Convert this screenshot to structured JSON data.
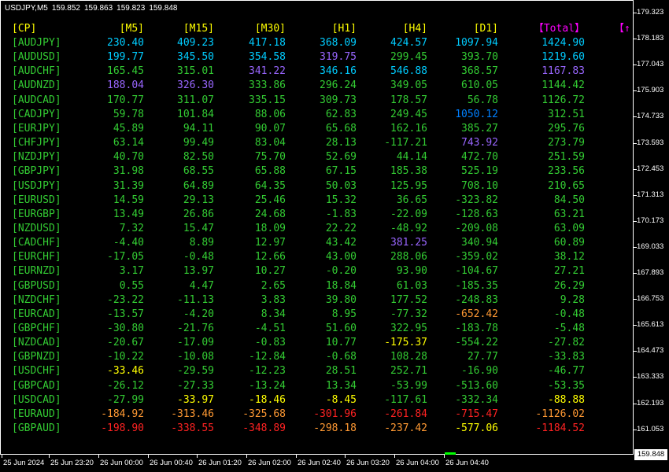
{
  "chart_header": {
    "symbol": "USDJPY,M5",
    "open": "159.852",
    "high": "159.863",
    "low": "159.823",
    "close": "159.848"
  },
  "price_scale": [
    "179.323",
    "178.183",
    "177.043",
    "175.903",
    "174.733",
    "173.593",
    "172.453",
    "171.313",
    "170.173",
    "169.033",
    "167.893",
    "166.753",
    "165.613",
    "164.473",
    "163.333",
    "162.193",
    "161.053"
  ],
  "current_price": "159.848",
  "time_scale": [
    "25 Jun 2024",
    "25 Jun 23:20",
    "26 Jun 00:00",
    "26 Jun 00:40",
    "26 Jun 01:20",
    "26 Jun 02:00",
    "26 Jun 02:40",
    "26 Jun 03:20",
    "26 Jun 04:00",
    "26 Jun 04:40"
  ],
  "table_headers": [
    "[CP]",
    "[M5]",
    "[M15]",
    "[M30]",
    "[H1]",
    "[H4]",
    "[D1]",
    "【Total】",
    "【↑"
  ],
  "header_colors": [
    "#ffff00",
    "#ffff00",
    "#ffff00",
    "#ffff00",
    "#ffff00",
    "#ffff00",
    "#ffff00",
    "#ff00ff",
    "#ff00ff"
  ],
  "colors": {
    "cyan": "#00ccff",
    "blue": "#0080ff",
    "purple": "#9966ff",
    "green": "#33cc33",
    "lime": "#00ff00",
    "yellow": "#ffff00",
    "orange": "#ff9933",
    "red": "#ff2222",
    "label": "#33cc33"
  },
  "rows": [
    {
      "pair": "[AUDJPY]",
      "values": [
        "230.40",
        "409.23",
        "417.18",
        "368.09",
        "424.57",
        "1097.94",
        "1424.90"
      ],
      "colors": [
        "cyan",
        "cyan",
        "cyan",
        "cyan",
        "cyan",
        "cyan",
        "cyan"
      ]
    },
    {
      "pair": "[AUDUSD]",
      "values": [
        "199.77",
        "345.50",
        "354.58",
        "319.75",
        "299.45",
        "393.70",
        "1219.60"
      ],
      "colors": [
        "cyan",
        "cyan",
        "cyan",
        "purple",
        "green",
        "green",
        "cyan"
      ]
    },
    {
      "pair": "[AUDCHF]",
      "values": [
        "165.45",
        "315.01",
        "341.22",
        "346.16",
        "546.88",
        "368.57",
        "1167.83"
      ],
      "colors": [
        "green",
        "green",
        "purple",
        "cyan",
        "cyan",
        "green",
        "purple"
      ]
    },
    {
      "pair": "[AUDNZD]",
      "values": [
        "188.04",
        "326.30",
        "333.86",
        "296.24",
        "349.05",
        "610.05",
        "1144.42"
      ],
      "colors": [
        "purple",
        "purple",
        "green",
        "green",
        "green",
        "green",
        "green"
      ]
    },
    {
      "pair": "[AUDCAD]",
      "values": [
        "170.77",
        "311.07",
        "335.15",
        "309.73",
        "178.57",
        "56.78",
        "1126.72"
      ],
      "colors": [
        "green",
        "green",
        "green",
        "green",
        "green",
        "green",
        "green"
      ]
    },
    {
      "pair": "[CADJPY]",
      "values": [
        "59.78",
        "101.84",
        "88.06",
        "62.83",
        "249.45",
        "1050.12",
        "312.51"
      ],
      "colors": [
        "green",
        "green",
        "green",
        "green",
        "green",
        "blue",
        "green"
      ]
    },
    {
      "pair": "[EURJPY]",
      "values": [
        "45.89",
        "94.11",
        "90.07",
        "65.68",
        "162.16",
        "385.27",
        "295.76"
      ],
      "colors": [
        "green",
        "green",
        "green",
        "green",
        "green",
        "green",
        "green"
      ]
    },
    {
      "pair": "[CHFJPY]",
      "values": [
        "63.14",
        "99.49",
        "83.04",
        "28.13",
        "-117.21",
        "743.92",
        "273.79"
      ],
      "colors": [
        "green",
        "green",
        "green",
        "green",
        "green",
        "purple",
        "green"
      ]
    },
    {
      "pair": "[NZDJPY]",
      "values": [
        "40.70",
        "82.50",
        "75.70",
        "52.69",
        "44.14",
        "472.70",
        "251.59"
      ],
      "colors": [
        "green",
        "green",
        "green",
        "green",
        "green",
        "green",
        "green"
      ]
    },
    {
      "pair": "[GBPJPY]",
      "values": [
        "31.98",
        "68.55",
        "65.88",
        "67.15",
        "185.38",
        "525.19",
        "233.56"
      ],
      "colors": [
        "green",
        "green",
        "green",
        "green",
        "green",
        "green",
        "green"
      ]
    },
    {
      "pair": "[USDJPY]",
      "values": [
        "31.39",
        "64.89",
        "64.35",
        "50.03",
        "125.95",
        "708.10",
        "210.65"
      ],
      "colors": [
        "green",
        "green",
        "green",
        "green",
        "green",
        "green",
        "green"
      ]
    },
    {
      "pair": "[EURUSD]",
      "values": [
        "14.59",
        "29.13",
        "25.46",
        "15.32",
        "36.65",
        "-323.82",
        "84.50"
      ],
      "colors": [
        "green",
        "green",
        "green",
        "green",
        "green",
        "green",
        "green"
      ]
    },
    {
      "pair": "[EURGBP]",
      "values": [
        "13.49",
        "26.86",
        "24.68",
        "-1.83",
        "-22.09",
        "-128.63",
        "63.21"
      ],
      "colors": [
        "green",
        "green",
        "green",
        "green",
        "green",
        "green",
        "green"
      ]
    },
    {
      "pair": "[NZDUSD]",
      "values": [
        "7.32",
        "15.47",
        "18.09",
        "22.22",
        "-48.92",
        "-209.08",
        "63.09"
      ],
      "colors": [
        "green",
        "green",
        "green",
        "green",
        "green",
        "green",
        "green"
      ]
    },
    {
      "pair": "[CADCHF]",
      "values": [
        "-4.40",
        "8.89",
        "12.97",
        "43.42",
        "381.25",
        "340.94",
        "60.89"
      ],
      "colors": [
        "green",
        "green",
        "green",
        "green",
        "purple",
        "green",
        "green"
      ]
    },
    {
      "pair": "[EURCHF]",
      "values": [
        "-17.05",
        "-0.48",
        "12.66",
        "43.00",
        "288.06",
        "-359.02",
        "38.12"
      ],
      "colors": [
        "green",
        "green",
        "green",
        "green",
        "green",
        "green",
        "green"
      ]
    },
    {
      "pair": "[EURNZD]",
      "values": [
        "3.17",
        "13.97",
        "10.27",
        "-0.20",
        "93.90",
        "-104.67",
        "27.21"
      ],
      "colors": [
        "green",
        "green",
        "green",
        "green",
        "green",
        "green",
        "green"
      ]
    },
    {
      "pair": "[GBPUSD]",
      "values": [
        "0.55",
        "4.47",
        "2.65",
        "18.84",
        "61.03",
        "-185.35",
        "26.29"
      ],
      "colors": [
        "green",
        "green",
        "green",
        "green",
        "green",
        "green",
        "green"
      ]
    },
    {
      "pair": "[NZDCHF]",
      "values": [
        "-23.22",
        "-11.13",
        "3.83",
        "39.80",
        "177.52",
        "-248.83",
        "9.28"
      ],
      "colors": [
        "green",
        "green",
        "green",
        "green",
        "green",
        "green",
        "green"
      ]
    },
    {
      "pair": "[EURCAD]",
      "values": [
        "-13.57",
        "-4.20",
        "8.34",
        "8.95",
        "-77.32",
        "-652.42",
        "-0.48"
      ],
      "colors": [
        "green",
        "green",
        "green",
        "green",
        "green",
        "orange",
        "green"
      ]
    },
    {
      "pair": "[GBPCHF]",
      "values": [
        "-30.80",
        "-21.76",
        "-4.51",
        "51.60",
        "322.95",
        "-183.78",
        "-5.48"
      ],
      "colors": [
        "green",
        "green",
        "green",
        "green",
        "green",
        "green",
        "green"
      ]
    },
    {
      "pair": "[NZDCAD]",
      "values": [
        "-20.67",
        "-17.09",
        "-0.83",
        "10.77",
        "-175.37",
        "-554.22",
        "-27.82"
      ],
      "colors": [
        "green",
        "green",
        "green",
        "green",
        "yellow",
        "green",
        "green"
      ]
    },
    {
      "pair": "[GBPNZD]",
      "values": [
        "-10.22",
        "-10.08",
        "-12.84",
        "-0.68",
        "108.28",
        "27.77",
        "-33.83"
      ],
      "colors": [
        "green",
        "green",
        "green",
        "green",
        "green",
        "green",
        "green"
      ]
    },
    {
      "pair": "[USDCHF]",
      "values": [
        "-33.46",
        "-29.59",
        "-12.23",
        "28.51",
        "252.71",
        "-16.90",
        "-46.77"
      ],
      "colors": [
        "yellow",
        "green",
        "green",
        "green",
        "green",
        "green",
        "green"
      ]
    },
    {
      "pair": "[GBPCAD]",
      "values": [
        "-26.12",
        "-27.33",
        "-13.24",
        "13.34",
        "-53.99",
        "-513.60",
        "-53.35"
      ],
      "colors": [
        "green",
        "green",
        "green",
        "green",
        "green",
        "green",
        "green"
      ]
    },
    {
      "pair": "[USDCAD]",
      "values": [
        "-27.99",
        "-33.97",
        "-18.46",
        "-8.45",
        "-117.61",
        "-332.34",
        "-88.88"
      ],
      "colors": [
        "green",
        "yellow",
        "yellow",
        "yellow",
        "green",
        "green",
        "yellow"
      ]
    },
    {
      "pair": "[EURAUD]",
      "values": [
        "-184.92",
        "-313.46",
        "-325.68",
        "-301.96",
        "-261.84",
        "-715.47",
        "-1126.02"
      ],
      "colors": [
        "orange",
        "orange",
        "orange",
        "red",
        "red",
        "red",
        "orange"
      ]
    },
    {
      "pair": "[GBPAUD]",
      "values": [
        "-198.90",
        "-338.55",
        "-348.89",
        "-298.18",
        "-237.42",
        "-577.06",
        "-1184.52"
      ],
      "colors": [
        "red",
        "red",
        "red",
        "orange",
        "orange",
        "yellow",
        "red"
      ]
    }
  ]
}
